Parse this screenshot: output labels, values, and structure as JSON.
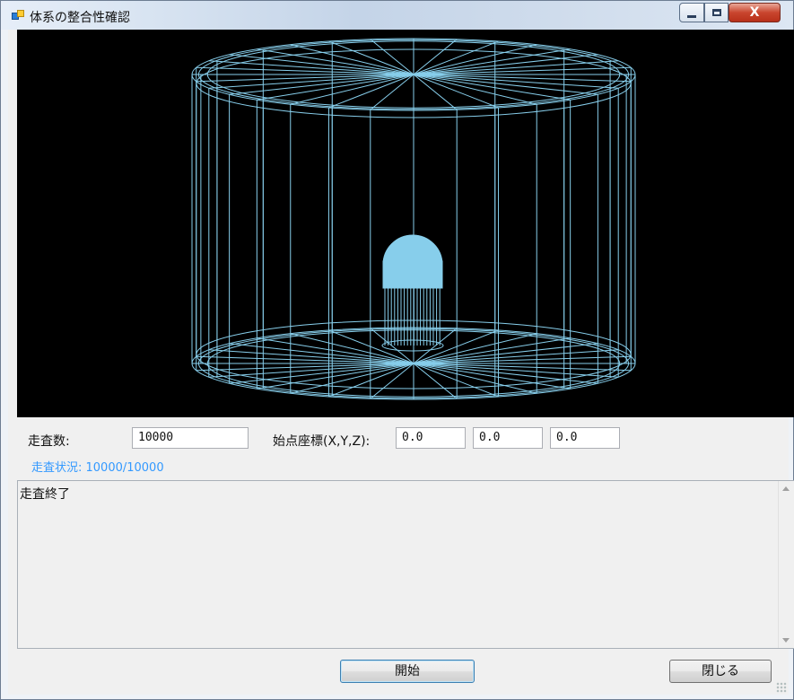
{
  "window": {
    "title": "体系の整合性確認"
  },
  "icons": {
    "app": "app-window-icon",
    "minimize": "minimize-icon",
    "maximize": "maximize-icon",
    "close": "close-icon"
  },
  "colors": {
    "viewport_bg": "#000000",
    "wireframe": "#87ceeb",
    "status": "#3399ff"
  },
  "scan": {
    "count_label": "走査数:",
    "count_value": "10000",
    "start_label": "始点座標(X,Y,Z):",
    "x": "0.0",
    "y": "0.0",
    "z": "0.0",
    "status": "走査状況: 10000/10000"
  },
  "log": {
    "text": "走査終了"
  },
  "buttons": {
    "start": "開始",
    "close": "閉じる"
  }
}
